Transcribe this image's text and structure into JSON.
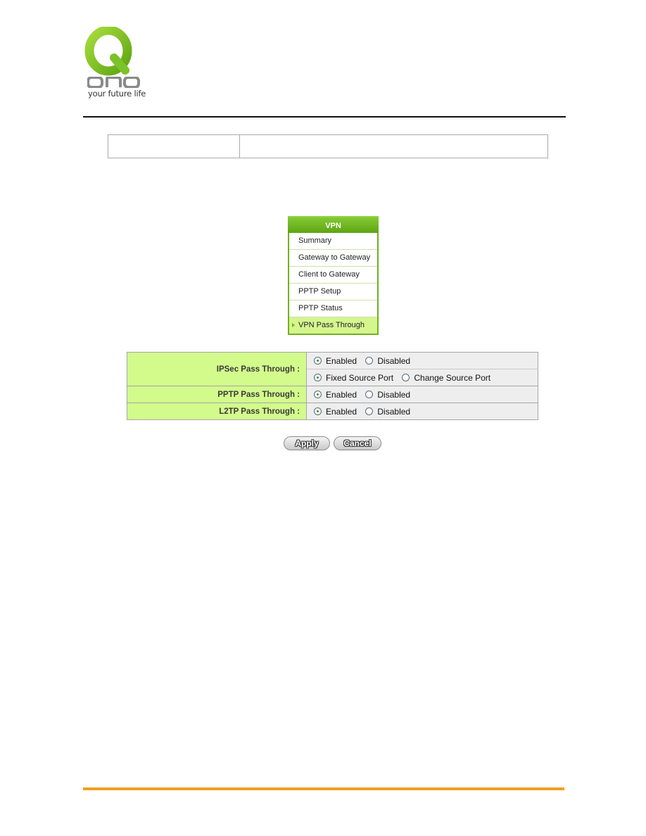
{
  "header": {
    "logo_text": "QNO",
    "tagline": "your future life"
  },
  "vpn_menu": {
    "title": "VPN",
    "items": [
      {
        "label": "Summary",
        "active": false
      },
      {
        "label": "Gateway to Gateway",
        "active": false
      },
      {
        "label": "Client to Gateway",
        "active": false
      },
      {
        "label": "PPTP Setup",
        "active": false
      },
      {
        "label": "PPTP Status",
        "active": false
      },
      {
        "label": "VPN Pass Through",
        "active": true
      }
    ]
  },
  "settings": {
    "ipsec": {
      "label": "IPSec Pass Through :",
      "row1": {
        "options": [
          "Enabled",
          "Disabled"
        ],
        "selected": "Enabled"
      },
      "row2": {
        "options": [
          "Fixed Source Port",
          "Change Source Port"
        ],
        "selected": "Fixed Source Port"
      }
    },
    "pptp": {
      "label": "PPTP Pass Through :",
      "options": [
        "Enabled",
        "Disabled"
      ],
      "selected": "Enabled"
    },
    "l2tp": {
      "label": "L2TP Pass Through :",
      "options": [
        "Enabled",
        "Disabled"
      ],
      "selected": "Enabled"
    }
  },
  "buttons": {
    "apply": "Apply",
    "cancel": "Cancel"
  },
  "colors": {
    "brand_green": "#6fb21c",
    "label_bg": "#d3fb8c",
    "footer_rule": "#f0a020"
  }
}
